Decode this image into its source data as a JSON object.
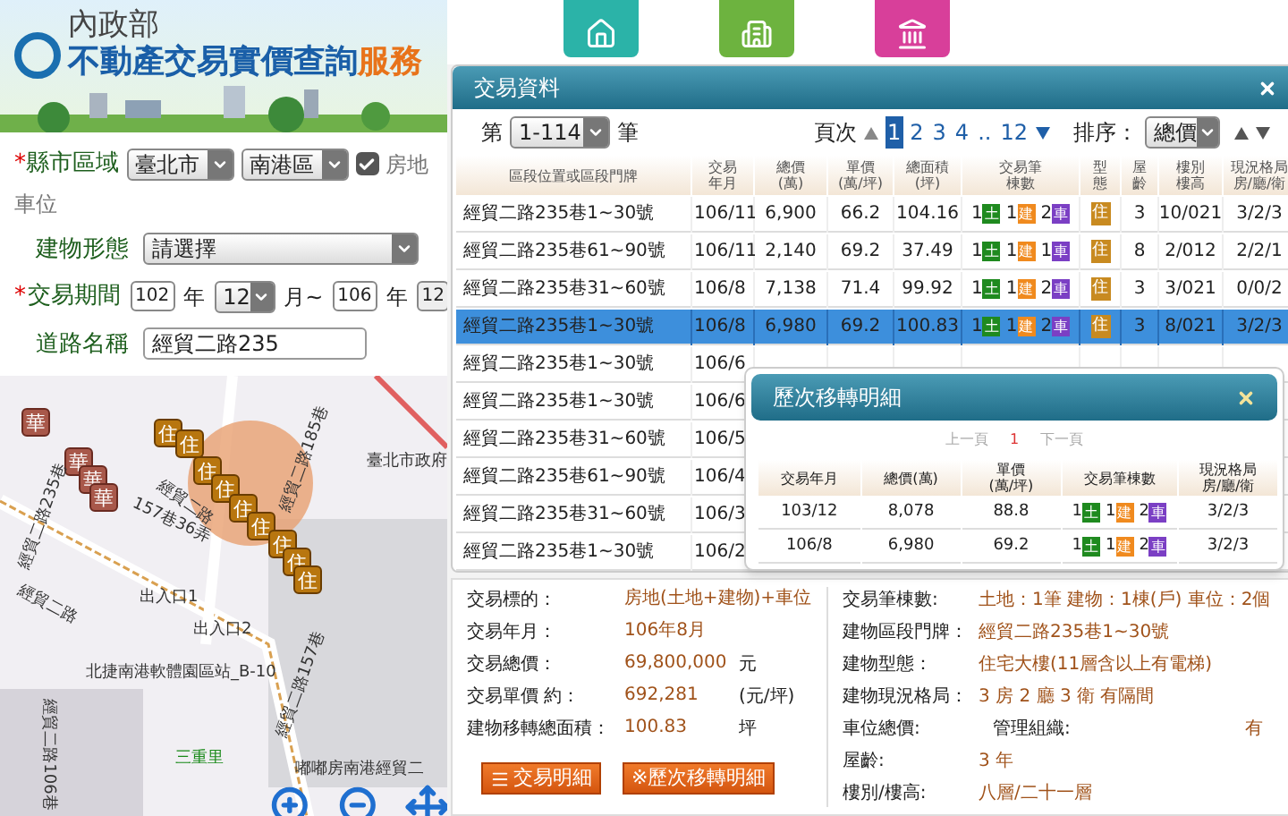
{
  "header": {
    "ministry": "內政部",
    "title": "不動產交易實價查詢",
    "title_accent": "服務"
  },
  "form": {
    "required_mark": "*",
    "region_label": "縣市區域",
    "city": "臺北市",
    "district": "南港區",
    "include_parking": {
      "checked": true,
      "label": "房地",
      "label_cont": "車位"
    },
    "type_label": "建物形態",
    "type_value": "請選擇",
    "period_label": "交易期間",
    "from_year": "102",
    "year_unit": "年",
    "from_month": "12",
    "to_sep": "月~",
    "to_year": "106",
    "to_year_unit": "年",
    "to_month": "12",
    "road_label": "道路名稱",
    "road_value": "經貿二路235"
  },
  "map": {
    "markers": [
      {
        "label": "華",
        "kind": "other"
      },
      {
        "label": "華",
        "kind": "other"
      },
      {
        "label": "華",
        "kind": "other"
      },
      {
        "label": "華",
        "kind": "other"
      },
      {
        "label": "住",
        "kind": "home"
      },
      {
        "label": "住",
        "kind": "home"
      },
      {
        "label": "住",
        "kind": "home"
      },
      {
        "label": "住",
        "kind": "home"
      },
      {
        "label": "住",
        "kind": "home"
      },
      {
        "label": "住",
        "kind": "home"
      },
      {
        "label": "住",
        "kind": "home"
      },
      {
        "label": "住",
        "kind": "home"
      },
      {
        "label": "住",
        "kind": "home"
      }
    ],
    "labels": [
      "臺北市政府",
      "經貿二路",
      "157巷36弄",
      "經貿二路",
      "出入口1",
      "出入口2",
      "北捷南港軟體園區站_B-10",
      "三重里",
      "嘟嘟房南港經貿二",
      "經貿二路106巷",
      "經貿二路157巷",
      "經貿二路185巷",
      "經貿二路235巷"
    ]
  },
  "dialog": {
    "title": "交易資料",
    "range_prefix": "第",
    "range": "1-114",
    "range_suffix": "筆",
    "page_label": "頁次",
    "pages": [
      {
        "label": "1",
        "selected": true
      },
      {
        "label": "2",
        "selected": false
      },
      {
        "label": "3",
        "selected": false
      },
      {
        "label": "4",
        "selected": false
      },
      {
        "label": "..",
        "selected": false
      },
      {
        "label": "12",
        "selected": false
      }
    ],
    "sort_label": "排序：",
    "sort_value": "總價",
    "columns": [
      "區段位置或區段門牌",
      "交易年月",
      "總價\n(萬)",
      "單價\n(萬/坪)",
      "總面積\n(坪)",
      "交易筆棟數",
      "型態",
      "屋齡",
      "樓別樓高",
      "現況格局房/廳/衛"
    ],
    "rows": [
      {
        "address": "經貿二路235巷1~30號",
        "date": "106/11",
        "total": "6,900",
        "unit": "66.2",
        "area": "104.16",
        "counts": [
          {
            "n": "1",
            "label": "土",
            "color": "#1f8a1f"
          },
          {
            "n": "1",
            "label": "建",
            "color": "#f08a1e"
          },
          {
            "n": "2",
            "label": "車",
            "color": "#7b3fc4"
          }
        ],
        "type": "住",
        "age": "3",
        "floor": "10/021",
        "layout": "3/2/3",
        "selected": false
      },
      {
        "address": "經貿二路235巷61~90號",
        "date": "106/11",
        "total": "2,140",
        "unit": "69.2",
        "area": "37.49",
        "counts": [
          {
            "n": "1",
            "label": "土",
            "color": "#1f8a1f"
          },
          {
            "n": "1",
            "label": "建",
            "color": "#f08a1e"
          },
          {
            "n": "1",
            "label": "車",
            "color": "#7b3fc4"
          }
        ],
        "type": "住",
        "age": "8",
        "floor": "2/012",
        "layout": "2/2/1",
        "selected": false
      },
      {
        "address": "經貿二路235巷31~60號",
        "date": "106/8",
        "total": "7,138",
        "unit": "71.4",
        "area": "99.92",
        "counts": [
          {
            "n": "1",
            "label": "土",
            "color": "#1f8a1f"
          },
          {
            "n": "1",
            "label": "建",
            "color": "#f08a1e"
          },
          {
            "n": "2",
            "label": "車",
            "color": "#7b3fc4"
          }
        ],
        "type": "住",
        "age": "3",
        "floor": "3/021",
        "layout": "0/0/2",
        "selected": false
      },
      {
        "address": "經貿二路235巷1~30號",
        "date": "106/8",
        "total": "6,980",
        "unit": "69.2",
        "area": "100.83",
        "counts": [
          {
            "n": "1",
            "label": "土",
            "color": "#1f8a1f"
          },
          {
            "n": "1",
            "label": "建",
            "color": "#f08a1e"
          },
          {
            "n": "2",
            "label": "車",
            "color": "#7b3fc4"
          }
        ],
        "type": "住",
        "age": "3",
        "floor": "8/021",
        "layout": "3/2/3",
        "selected": true
      },
      {
        "address": "經貿二路235巷1~30號",
        "date": "106/6",
        "selected": false
      },
      {
        "address": "經貿二路235巷1~30號",
        "date": "106/6",
        "selected": false
      },
      {
        "address": "經貿二路235巷31~60號",
        "date": "106/5",
        "selected": false
      },
      {
        "address": "經貿二路235巷61~90號",
        "date": "106/4",
        "selected": false
      },
      {
        "address": "經貿二路235巷31~60號",
        "date": "106/3",
        "selected": false
      },
      {
        "address": "經貿二路235巷1~30號",
        "date": "106/2",
        "selected": false
      }
    ]
  },
  "history": {
    "title": "歷次移轉明細",
    "prev": "上一頁",
    "page": "1",
    "next": "下一頁",
    "columns": [
      "交易年月",
      "總價(萬)",
      "單價\n(萬/坪)",
      "交易筆棟數",
      "現況格局房/廳/衛"
    ],
    "rows": [
      {
        "date": "103/12",
        "total": "8,078",
        "unit": "88.8",
        "counts": [
          {
            "n": "1",
            "label": "土",
            "color": "#1f8a1f"
          },
          {
            "n": "1",
            "label": "建",
            "color": "#f08a1e"
          },
          {
            "n": "2",
            "label": "車",
            "color": "#7b3fc4"
          }
        ],
        "layout": "3/2/3"
      },
      {
        "date": "106/8",
        "total": "6,980",
        "unit": "69.2",
        "counts": [
          {
            "n": "1",
            "label": "土",
            "color": "#1f8a1f"
          },
          {
            "n": "1",
            "label": "建",
            "color": "#f08a1e"
          },
          {
            "n": "2",
            "label": "車",
            "color": "#7b3fc4"
          }
        ],
        "layout": "3/2/3"
      }
    ]
  },
  "details": {
    "left": [
      {
        "label": "交易標的：",
        "value": "房地(土地+建物)+車位"
      },
      {
        "label": "交易年月：",
        "value": "106年8月"
      },
      {
        "label": "交易總價：",
        "value": "69,800,000",
        "unit": "元"
      },
      {
        "label": "交易單價 約：",
        "value": "692,281",
        "unit": "(元/坪)"
      },
      {
        "label": "建物移轉總面積：",
        "value": "100.83",
        "unit": "坪"
      }
    ],
    "right": [
      {
        "label": "交易筆棟數:",
        "value": "土地：1筆 建物：1棟(戶) 車位：2個"
      },
      {
        "label": "建物區段門牌：",
        "value": "經貿二路235巷1~30號"
      },
      {
        "label": "建物型態：",
        "value": "住宅大樓(11層含以上有電梯)"
      },
      {
        "label": "建物現況格局：",
        "value": "3 房 2 廳 3 衛 有隔間"
      },
      {
        "label": "車位總價:",
        "value": "管理組織:",
        "extra": "有"
      },
      {
        "label": "屋齡:",
        "value": "3  年"
      },
      {
        "label": "樓別/樓高:",
        "value": "八層/二十一層"
      }
    ],
    "buttons": [
      {
        "label": "交易明細",
        "kind": "list"
      },
      {
        "label": "※歷次移轉明細",
        "kind": "plain"
      }
    ]
  }
}
